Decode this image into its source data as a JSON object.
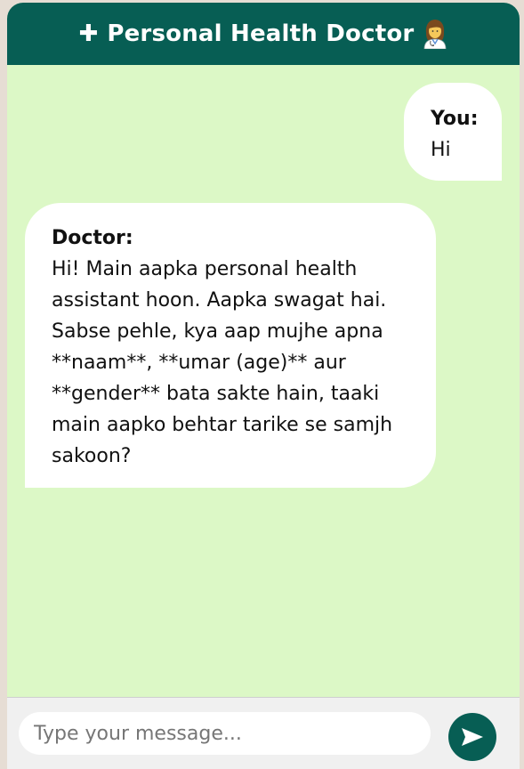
{
  "header": {
    "icon_glyph": "✚",
    "title": "Personal Health Doctor",
    "emoji": "doctor-woman-icon"
  },
  "messages": [
    {
      "role": "user",
      "sender": "You:",
      "text": "Hi"
    },
    {
      "role": "bot",
      "sender": "Doctor:",
      "text": "Hi! Main aapka personal health assistant hoon. Aapka swagat hai. Sabse pehle, kya aap mujhe apna **naam**, **umar (age)** aur **gender** bata sakte hain, taaki main aapko behtar tarike se samjh sakoon?"
    }
  ],
  "input": {
    "placeholder": "Type your message...",
    "value": ""
  },
  "send_button": {
    "icon": "send-arrow-icon"
  },
  "colors": {
    "header_bg": "#075e54",
    "chat_bg": "#dcf8c6",
    "bubble_bg": "#ffffff",
    "input_bar_bg": "#f0f0f0",
    "page_bg": "#e6ddd4"
  }
}
